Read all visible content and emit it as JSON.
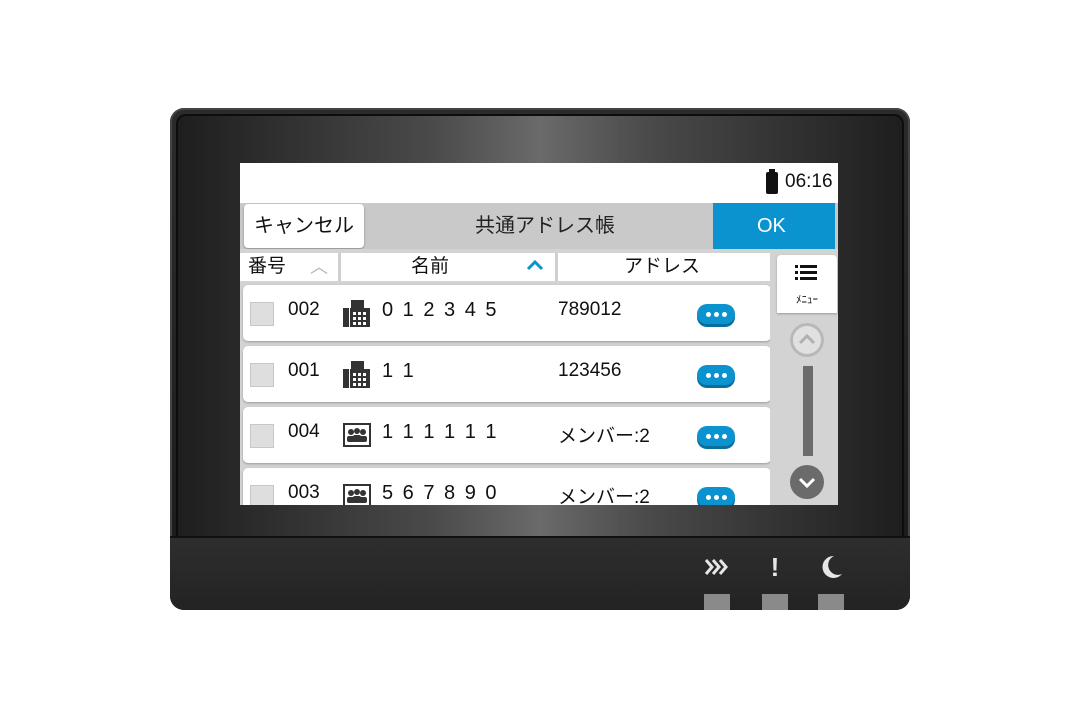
{
  "status": {
    "time": "06:16"
  },
  "titlebar": {
    "cancel_label": "キャンセル",
    "title": "共通アドレス帳",
    "ok_label": "OK"
  },
  "columns": {
    "number": "番号",
    "name": "名前",
    "address": "アドレス"
  },
  "rows": [
    {
      "number": "002",
      "type": "fax-icon",
      "name": "0 1 2 3 4 5",
      "address": "789012"
    },
    {
      "number": "001",
      "type": "fax-icon",
      "name": "1 1",
      "address": "123456"
    },
    {
      "number": "004",
      "type": "group-icon",
      "name": "1 1 1 1 1 1",
      "address": "メンバー:2"
    },
    {
      "number": "003",
      "type": "group-icon",
      "name": "5 6 7 8 9 0",
      "address": "メンバー:2"
    }
  ],
  "sidebar": {
    "menu_label": "ﾒﾆｭｰ"
  },
  "panel": {
    "icons": [
      "processing-icon",
      "attention-icon",
      "energy-saver-icon"
    ]
  },
  "colors": {
    "accent": "#0a93cf",
    "bezel": "#1f1f1f"
  }
}
